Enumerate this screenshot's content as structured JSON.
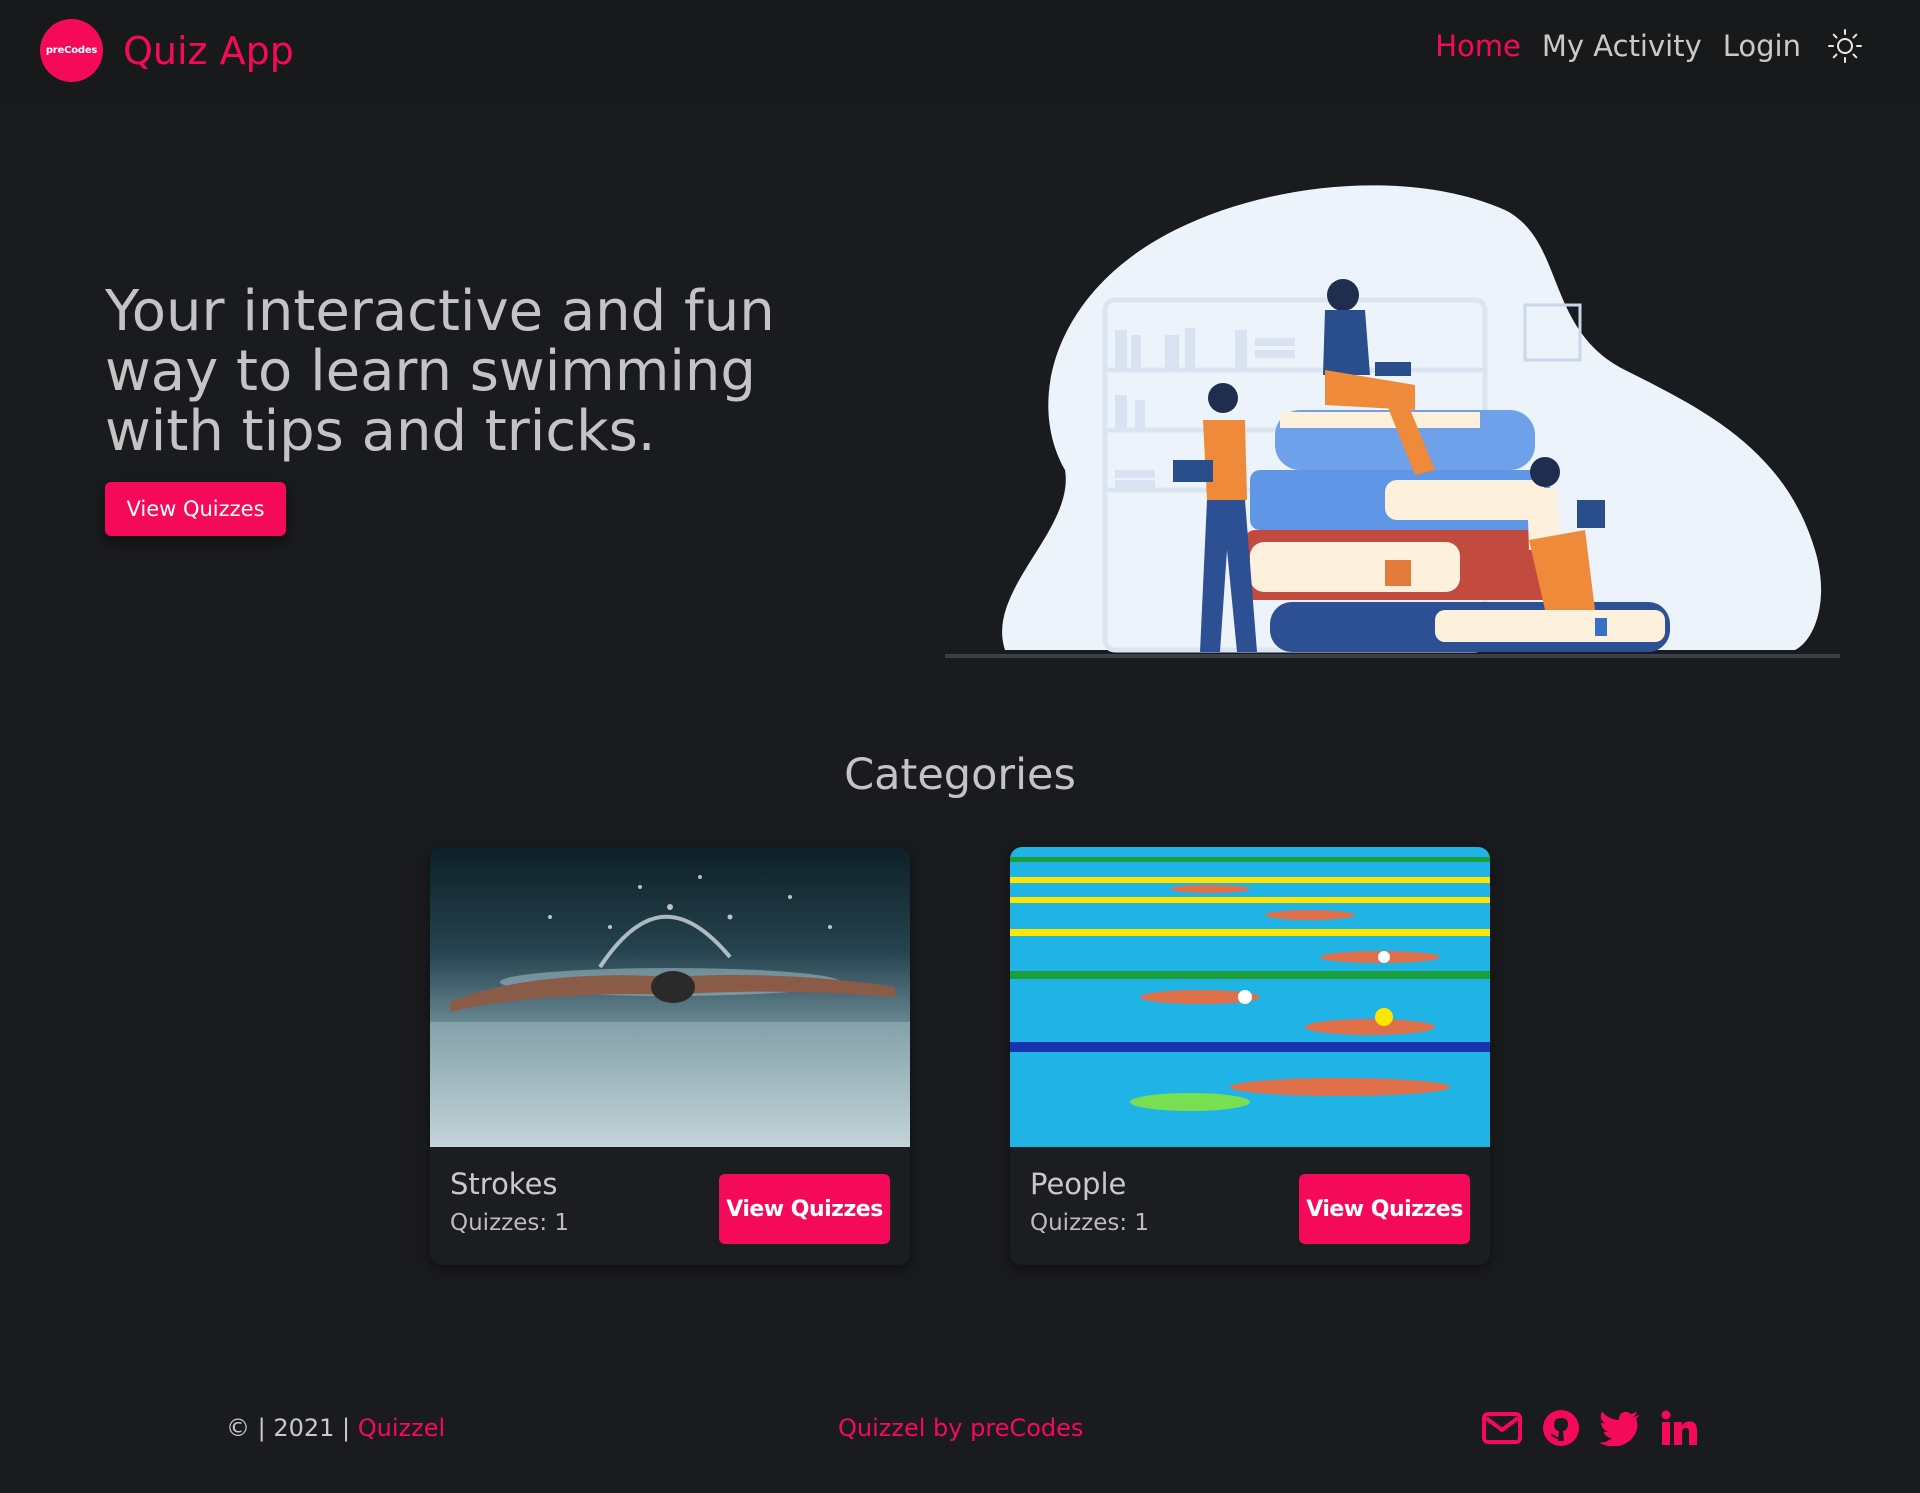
{
  "brand": {
    "logo_text": "preCodes",
    "name": "Quiz App"
  },
  "nav": {
    "items": [
      {
        "label": "Home",
        "active": true
      },
      {
        "label": "My Activity",
        "active": false
      },
      {
        "label": "Login",
        "active": false
      }
    ],
    "theme_icon": "sun-icon"
  },
  "hero": {
    "headline": "Your interactive and fun way to learn swimming with tips and tricks.",
    "button_label": "View Quizzes"
  },
  "categories": {
    "title": "Categories",
    "items": [
      {
        "name": "Strokes",
        "count_label": "Quizzes: 1",
        "button_label": "View Quizzes"
      },
      {
        "name": "People",
        "count_label": "Quizzes: 1",
        "button_label": "View Quizzes"
      }
    ]
  },
  "footer": {
    "copyright_prefix": "© | 2021 | ",
    "copyright_link": "Quizzel",
    "center_text": "Quizzel by preCodes",
    "icons": [
      "mail-icon",
      "github-icon",
      "twitter-icon",
      "linkedin-icon"
    ]
  },
  "colors": {
    "accent": "#f50a5a",
    "background": "#1a1b1e",
    "text": "#c9c9c9"
  }
}
